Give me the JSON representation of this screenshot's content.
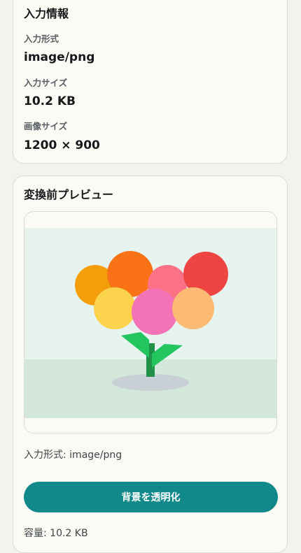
{
  "info": {
    "title": "入力情報",
    "format_label": "入力形式",
    "format_value": "image/png",
    "size_label": "入力サイズ",
    "size_value": "10.2 KB",
    "dimensions_label": "画像サイズ",
    "dimensions_value": "1200 × 900"
  },
  "preview": {
    "title": "変換前プレビュー",
    "format_text": "入力形式: image/png",
    "convert_button": "背景を透明化",
    "capacity_text": "容量: 10.2 KB",
    "image_alt": "flower illustration"
  },
  "colors": {
    "page_bg": "#f3f2ee",
    "card_bg": "#fbfaf5",
    "accent": "#11898a"
  }
}
